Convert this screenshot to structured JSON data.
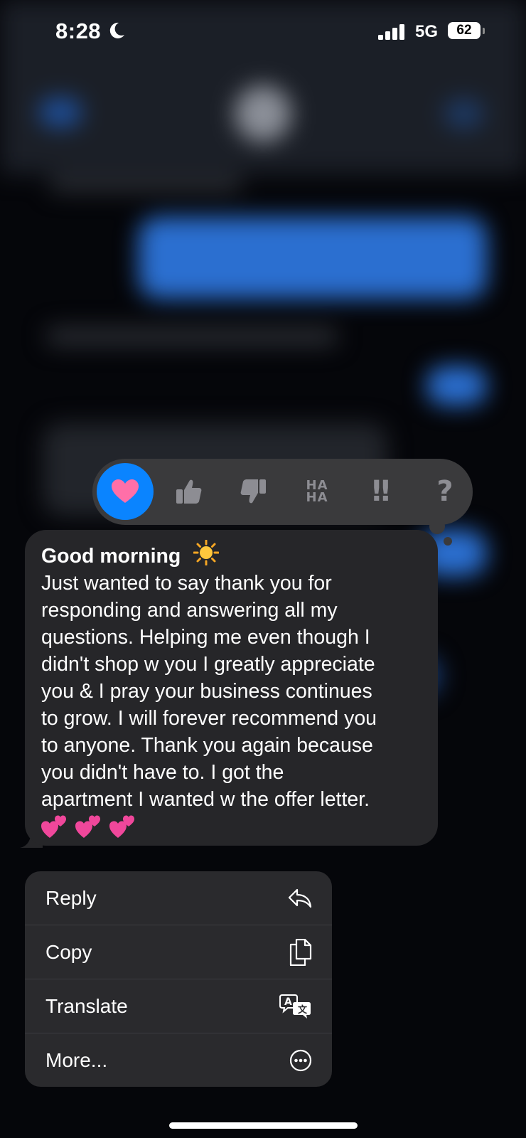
{
  "status_bar": {
    "time": "8:28",
    "network": "5G",
    "battery": "62"
  },
  "reactions": {
    "items": [
      {
        "name": "heart",
        "selected": true
      },
      {
        "name": "thumbs-up"
      },
      {
        "name": "thumbs-down"
      },
      {
        "name": "haha",
        "text_top": "HA",
        "text_bottom": "HA"
      },
      {
        "name": "emphasize",
        "text": "‼"
      },
      {
        "name": "question",
        "text": "?"
      }
    ],
    "selected_color": "#0a84ff",
    "heart_color": "#ff6fa8"
  },
  "message": {
    "title": "Good morning",
    "title_emoji": "sun",
    "lines": [
      "Just wanted to say thank you for",
      "responding and answering all my",
      "questions. Helping me even though I",
      "didn't shop w you I greatly appreciate",
      "you & I pray your business continues",
      "to grow. I will forever recommend you",
      "to anyone. Thank you again because",
      "you didn't have to. I got the",
      "apartment I wanted w the offer letter."
    ],
    "trailing_emojis": [
      "two-hearts",
      "two-hearts",
      "two-hearts"
    ]
  },
  "context_menu": {
    "items": [
      {
        "label": "Reply",
        "icon": "reply-icon"
      },
      {
        "label": "Copy",
        "icon": "copy-icon"
      },
      {
        "label": "Translate",
        "icon": "translate-icon"
      },
      {
        "label": "More...",
        "icon": "more-icon"
      }
    ]
  }
}
